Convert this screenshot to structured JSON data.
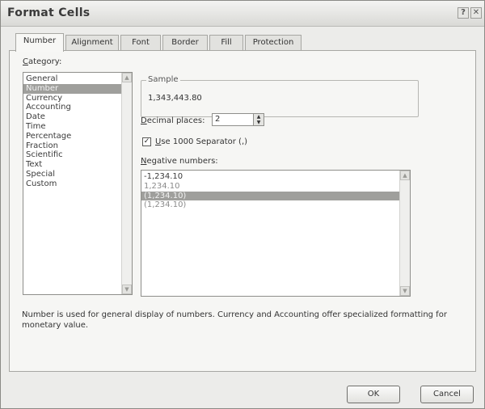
{
  "window": {
    "title": "Format Cells",
    "help_glyph": "?",
    "close_glyph": "✕"
  },
  "tabs": [
    {
      "label": "Number",
      "active": true
    },
    {
      "label": "Alignment",
      "active": false
    },
    {
      "label": "Font",
      "active": false
    },
    {
      "label": "Border",
      "active": false
    },
    {
      "label": "Fill",
      "active": false
    },
    {
      "label": "Protection",
      "active": false
    }
  ],
  "category": {
    "label_prefix": "C",
    "label_rest": "ategory:",
    "selected": "Number",
    "items": [
      "General",
      "Number",
      "Currency",
      "Accounting",
      "Date",
      "Time",
      "Percentage",
      "Fraction",
      "Scientific",
      "Text",
      "Special",
      "Custom"
    ]
  },
  "sample": {
    "legend": "Sample",
    "value": "1,343,443.80"
  },
  "decimal_places": {
    "label_prefix": "D",
    "label_rest": "ecimal places:",
    "value": "2"
  },
  "separator": {
    "checked": true,
    "check_glyph": "✓",
    "label_prefix": "U",
    "label_rest": "se 1000 Separator (,)"
  },
  "negative_numbers": {
    "label_prefix": "N",
    "label_rest": "egative numbers:",
    "items": [
      "-1,234.10",
      "1,234.10",
      "(1,234.10)",
      "(1,234.10)"
    ],
    "selected_index": 2
  },
  "description": "Number is used for general display of numbers.  Currency and Accounting offer specialized formatting for monetary value.",
  "buttons": {
    "ok": "OK",
    "cancel": "Cancel"
  },
  "colors": {
    "dialog_bg": "#ececea",
    "selection": "#9f9f9c",
    "negative_red_faded": "#8a8a8a"
  }
}
